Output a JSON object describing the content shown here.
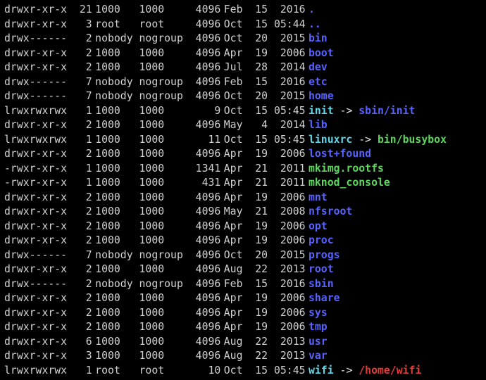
{
  "listing": [
    {
      "perms": "drwxr-xr-x",
      "links": "21",
      "owner": "1000",
      "group": "1000",
      "size": "4096",
      "month": "Feb",
      "day": "15",
      "time": "2016",
      "name": ".",
      "ncls": "c-blue"
    },
    {
      "perms": "drwxr-xr-x",
      "links": "3",
      "owner": "root",
      "group": "root",
      "size": "4096",
      "month": "Oct",
      "day": "15",
      "time": "05:44",
      "name": "..",
      "ncls": "c-blue"
    },
    {
      "perms": "drwx------",
      "links": "2",
      "owner": "nobody",
      "group": "nogroup",
      "size": "4096",
      "month": "Oct",
      "day": "20",
      "time": "2015",
      "name": "bin",
      "ncls": "c-blue"
    },
    {
      "perms": "drwxr-xr-x",
      "links": "2",
      "owner": "1000",
      "group": "1000",
      "size": "4096",
      "month": "Apr",
      "day": "19",
      "time": "2006",
      "name": "boot",
      "ncls": "c-blue"
    },
    {
      "perms": "drwxr-xr-x",
      "links": "2",
      "owner": "1000",
      "group": "1000",
      "size": "4096",
      "month": "Jul",
      "day": "28",
      "time": "2014",
      "name": "dev",
      "ncls": "c-blue"
    },
    {
      "perms": "drwx------",
      "links": "7",
      "owner": "nobody",
      "group": "nogroup",
      "size": "4096",
      "month": "Feb",
      "day": "15",
      "time": "2016",
      "name": "etc",
      "ncls": "c-blue"
    },
    {
      "perms": "drwx------",
      "links": "7",
      "owner": "nobody",
      "group": "nogroup",
      "size": "4096",
      "month": "Oct",
      "day": "20",
      "time": "2015",
      "name": "home",
      "ncls": "c-blue"
    },
    {
      "perms": "lrwxrwxrwx",
      "links": "1",
      "owner": "1000",
      "group": "1000",
      "size": "9",
      "month": "Oct",
      "day": "15",
      "time": "05:45",
      "name": "init",
      "ncls": "c-cyan",
      "larrow": " -> ",
      "ltarget": "sbin/init",
      "lcls": "c-blue"
    },
    {
      "perms": "drwxr-xr-x",
      "links": "2",
      "owner": "1000",
      "group": "1000",
      "size": "4096",
      "month": "May",
      "day": "4",
      "time": "2014",
      "name": "lib",
      "ncls": "c-blue"
    },
    {
      "perms": "lrwxrwxrwx",
      "links": "1",
      "owner": "1000",
      "group": "1000",
      "size": "11",
      "month": "Oct",
      "day": "15",
      "time": "05:45",
      "name": "linuxrc",
      "ncls": "c-cyan",
      "larrow": " -> ",
      "ltarget": "bin/busybox",
      "lcls": "c-green"
    },
    {
      "perms": "drwxr-xr-x",
      "links": "2",
      "owner": "1000",
      "group": "1000",
      "size": "4096",
      "month": "Apr",
      "day": "19",
      "time": "2006",
      "name": "lost+found",
      "ncls": "c-blue"
    },
    {
      "perms": "-rwxr-xr-x",
      "links": "1",
      "owner": "1000",
      "group": "1000",
      "size": "1341",
      "month": "Apr",
      "day": "21",
      "time": "2011",
      "name": "mkimg.rootfs",
      "ncls": "c-green"
    },
    {
      "perms": "-rwxr-xr-x",
      "links": "1",
      "owner": "1000",
      "group": "1000",
      "size": "431",
      "month": "Apr",
      "day": "21",
      "time": "2011",
      "name": "mknod_console",
      "ncls": "c-green"
    },
    {
      "perms": "drwxr-xr-x",
      "links": "2",
      "owner": "1000",
      "group": "1000",
      "size": "4096",
      "month": "Apr",
      "day": "19",
      "time": "2006",
      "name": "mnt",
      "ncls": "c-blue"
    },
    {
      "perms": "drwxr-xr-x",
      "links": "2",
      "owner": "1000",
      "group": "1000",
      "size": "4096",
      "month": "May",
      "day": "21",
      "time": "2008",
      "name": "nfsroot",
      "ncls": "c-blue"
    },
    {
      "perms": "drwxr-xr-x",
      "links": "2",
      "owner": "1000",
      "group": "1000",
      "size": "4096",
      "month": "Apr",
      "day": "19",
      "time": "2006",
      "name": "opt",
      "ncls": "c-blue"
    },
    {
      "perms": "drwxr-xr-x",
      "links": "2",
      "owner": "1000",
      "group": "1000",
      "size": "4096",
      "month": "Apr",
      "day": "19",
      "time": "2006",
      "name": "proc",
      "ncls": "c-blue"
    },
    {
      "perms": "drwx------",
      "links": "7",
      "owner": "nobody",
      "group": "nogroup",
      "size": "4096",
      "month": "Oct",
      "day": "20",
      "time": "2015",
      "name": "progs",
      "ncls": "c-blue"
    },
    {
      "perms": "drwxr-xr-x",
      "links": "2",
      "owner": "1000",
      "group": "1000",
      "size": "4096",
      "month": "Aug",
      "day": "22",
      "time": "2013",
      "name": "root",
      "ncls": "c-blue"
    },
    {
      "perms": "drwx------",
      "links": "2",
      "owner": "nobody",
      "group": "nogroup",
      "size": "4096",
      "month": "Feb",
      "day": "15",
      "time": "2016",
      "name": "sbin",
      "ncls": "c-blue"
    },
    {
      "perms": "drwxr-xr-x",
      "links": "2",
      "owner": "1000",
      "group": "1000",
      "size": "4096",
      "month": "Apr",
      "day": "19",
      "time": "2006",
      "name": "share",
      "ncls": "c-blue"
    },
    {
      "perms": "drwxr-xr-x",
      "links": "2",
      "owner": "1000",
      "group": "1000",
      "size": "4096",
      "month": "Apr",
      "day": "19",
      "time": "2006",
      "name": "sys",
      "ncls": "c-blue"
    },
    {
      "perms": "drwxr-xr-x",
      "links": "2",
      "owner": "1000",
      "group": "1000",
      "size": "4096",
      "month": "Apr",
      "day": "19",
      "time": "2006",
      "name": "tmp",
      "ncls": "c-blue"
    },
    {
      "perms": "drwxr-xr-x",
      "links": "6",
      "owner": "1000",
      "group": "1000",
      "size": "4096",
      "month": "Aug",
      "day": "22",
      "time": "2013",
      "name": "usr",
      "ncls": "c-blue"
    },
    {
      "perms": "drwxr-xr-x",
      "links": "3",
      "owner": "1000",
      "group": "1000",
      "size": "4096",
      "month": "Aug",
      "day": "22",
      "time": "2013",
      "name": "var",
      "ncls": "c-blue"
    },
    {
      "perms": "lrwxrwxrwx",
      "links": "1",
      "owner": "root",
      "group": "root",
      "size": "10",
      "month": "Oct",
      "day": "15",
      "time": "05:45",
      "name": "wifi",
      "ncls": "c-cyan",
      "larrow": " -> ",
      "ltarget": "/home/wifi",
      "lcls": "c-red"
    }
  ]
}
